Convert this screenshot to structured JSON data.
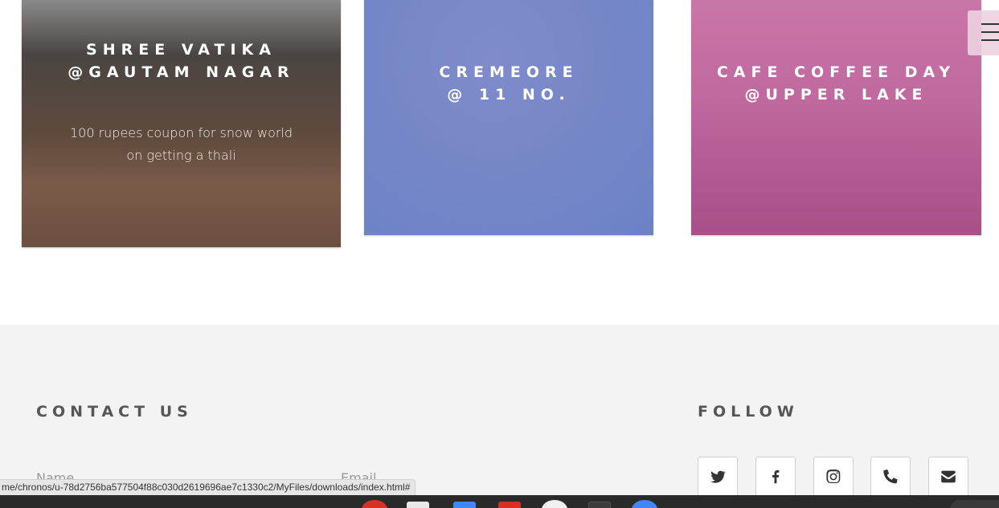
{
  "cards": [
    {
      "title_line1": "SHREE VATIKA",
      "title_line2": "@GAUTAM NAGAR",
      "description": "100 rupees coupon for snow world on getting a thali"
    },
    {
      "title_line1": "CREMEORE",
      "title_line2": "@ 11 NO."
    },
    {
      "title_line1": "CAFE COFFEE DAY",
      "title_line2": "@UPPER LAKE"
    }
  ],
  "footer": {
    "contact_title": "CONTACT US",
    "follow_title": "FOLLOW",
    "name_placeholder": "Name",
    "email_placeholder": "Email",
    "social_icons": [
      "twitter-icon",
      "facebook-icon",
      "instagram-icon",
      "phone-icon",
      "envelope-icon"
    ]
  },
  "browser": {
    "status_url": "me/chronos/u-78d2756ba577504f88c030d2619696ae7c1330c2/MyFiles/downloads/index.html#"
  },
  "colors": {
    "card_blue": "#7687c8",
    "card_pink": "#c06aa0",
    "card_brown": "#6b4f3f",
    "footer_bg": "#f3f3f3",
    "heading_text": "#555555"
  }
}
